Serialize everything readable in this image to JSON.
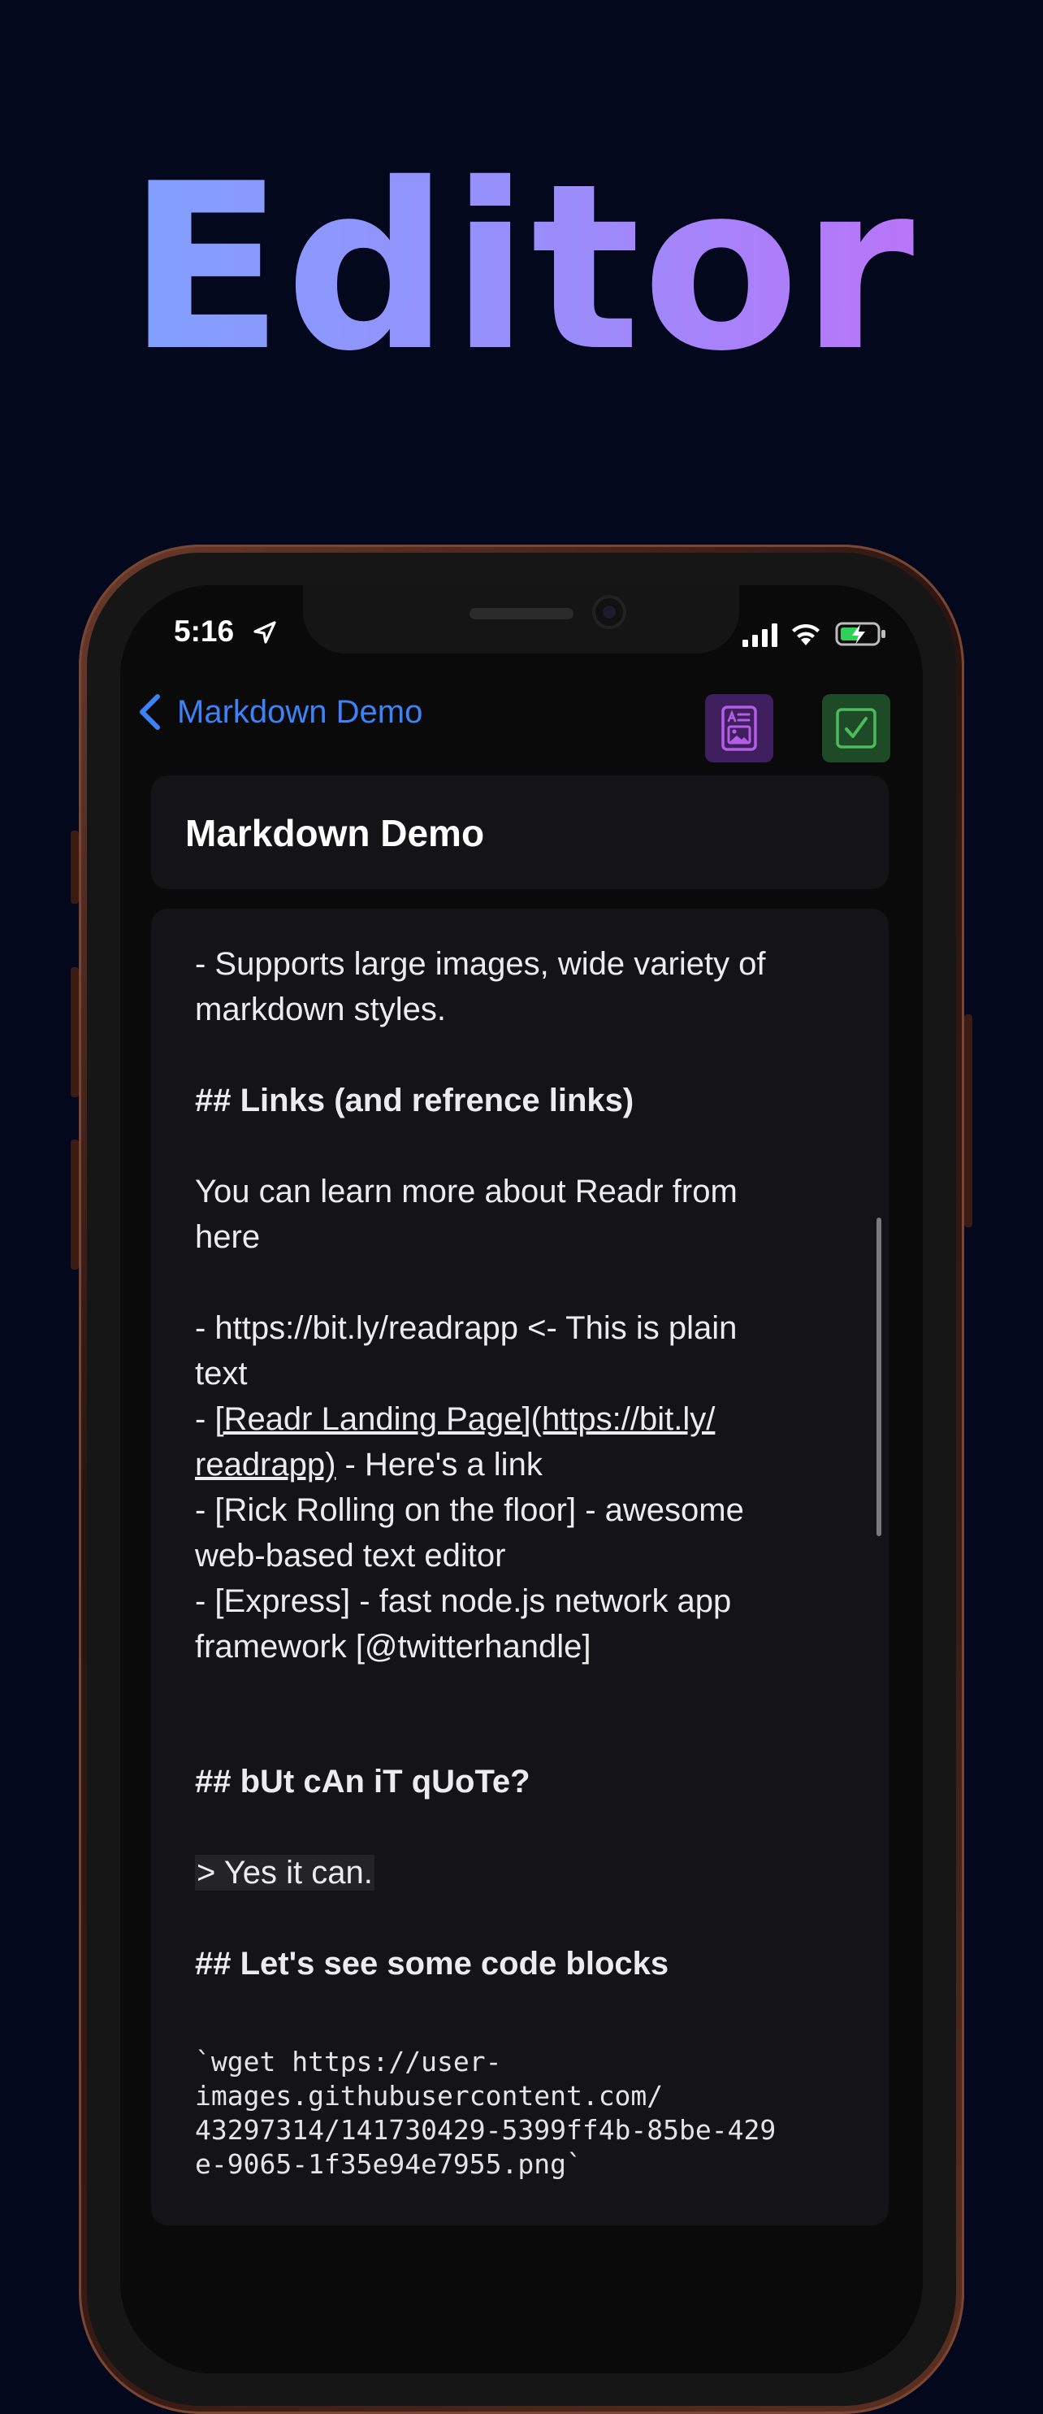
{
  "hero": {
    "title": "Editor"
  },
  "status_bar": {
    "time": "5:16"
  },
  "nav": {
    "back_label": "Markdown Demo",
    "preview_icon": "document-preview-icon",
    "done_icon": "checkmark-icon"
  },
  "document": {
    "title": "Markdown Demo",
    "lines": {
      "l1": "- Supports large images, wide variety of",
      "l2": "markdown styles.",
      "l3": "## Links (and refrence links)",
      "l4": "You can learn more about Readr from",
      "l5": "here",
      "l6": "- https://bit.ly/readrapp <- This is plain",
      "l7": "text",
      "l8_prefix": "- ",
      "l8_link": "[Readr Landing Page](https://bit.ly/",
      "l9_link": "readrapp)",
      "l9_suffix": " - Here's a link",
      "l10": "- [Rick Rolling on the floor] - awesome",
      "l11": "web-based text editor",
      "l12": "- [Express] - fast node.js network app",
      "l13": "framework [@twitterhandle]",
      "l14": "## bUt cAn iT qUoTe?",
      "l15": "> Yes it can.",
      "l16": "## Let's see some code blocks",
      "code1": "`wget https://user-",
      "code2": "images.githubusercontent.com/",
      "code3": "43297314/141730429-5399ff4b-85be-429",
      "code4": "e-9065-1f35e94e7955.png`"
    }
  },
  "colors": {
    "background": "#04081c",
    "accent_blue": "#3d82f7",
    "title_gradient_start": "#7aa6ff",
    "title_gradient_end": "#c46cf7",
    "preview_button": "#3f1f5e",
    "done_button": "#1f4a28"
  }
}
